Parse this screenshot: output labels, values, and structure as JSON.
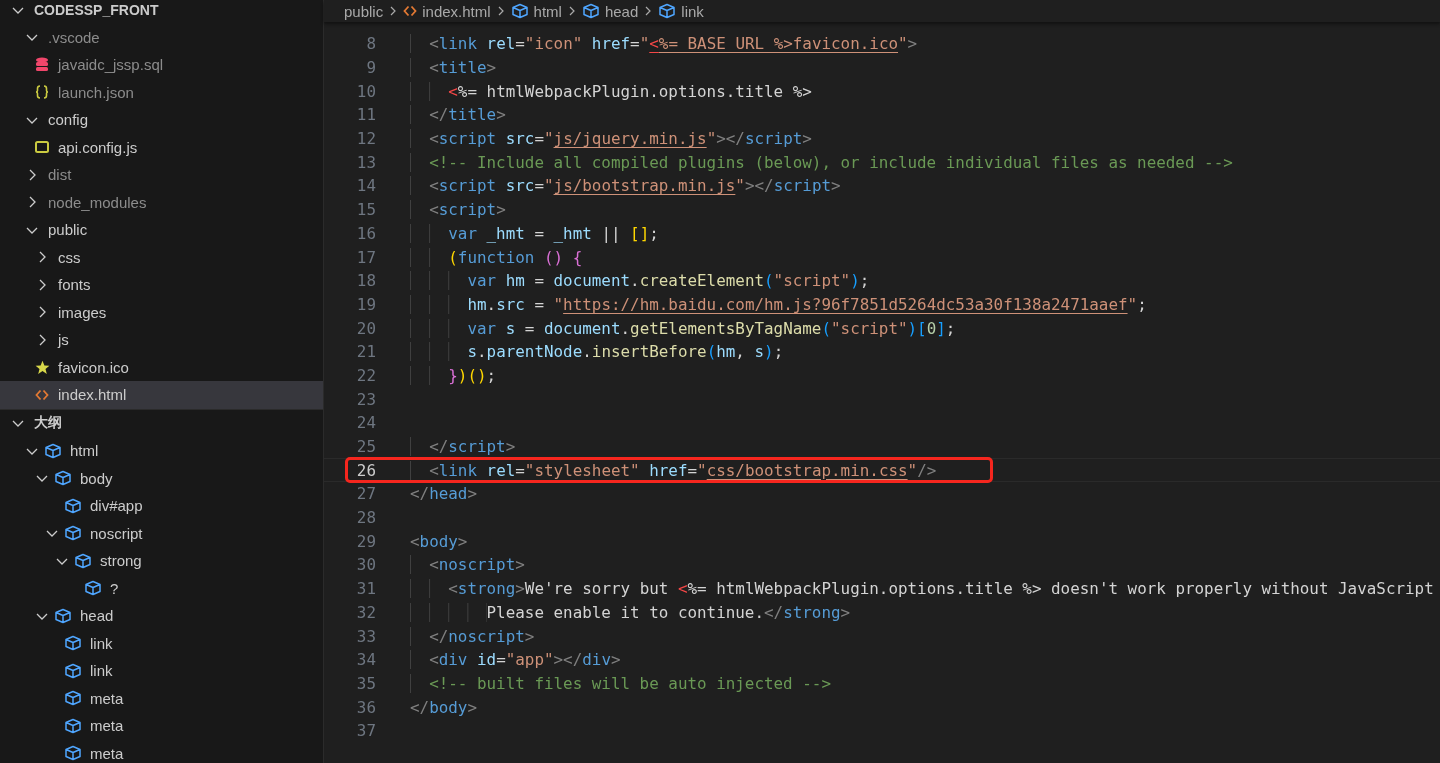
{
  "explorer": {
    "title": "CODESSP_FRONT",
    "expanded": true,
    "items": [
      {
        "label": ".vscode",
        "kind": "folder",
        "expanded": true,
        "dimmed": true,
        "selected": false,
        "children": [
          {
            "label": "javaidc_jssp.sql",
            "kind": "sql",
            "dimmed": true,
            "selected": false
          },
          {
            "label": "launch.json",
            "kind": "json",
            "dimmed": true,
            "selected": false
          }
        ]
      },
      {
        "label": "config",
        "kind": "folder",
        "expanded": true,
        "dimmed": false,
        "selected": false,
        "children": [
          {
            "label": "api.config.js",
            "kind": "js",
            "dimmed": false,
            "selected": false
          }
        ]
      },
      {
        "label": "dist",
        "kind": "folder",
        "expanded": false,
        "dimmed": true,
        "selected": false
      },
      {
        "label": "node_modules",
        "kind": "folder",
        "expanded": false,
        "dimmed": true,
        "selected": false
      },
      {
        "label": "public",
        "kind": "folder",
        "expanded": true,
        "dimmed": false,
        "selected": false,
        "children": [
          {
            "label": "css",
            "kind": "folder",
            "expanded": false,
            "dimmed": false,
            "selected": false
          },
          {
            "label": "fonts",
            "kind": "folder",
            "expanded": false,
            "dimmed": false,
            "selected": false
          },
          {
            "label": "images",
            "kind": "folder",
            "expanded": false,
            "dimmed": false,
            "selected": false
          },
          {
            "label": "js",
            "kind": "folder",
            "expanded": false,
            "dimmed": false,
            "selected": false
          },
          {
            "label": "favicon.ico",
            "kind": "star",
            "dimmed": false,
            "selected": false
          },
          {
            "label": "index.html",
            "kind": "html",
            "dimmed": false,
            "selected": true
          }
        ]
      }
    ]
  },
  "outline": {
    "title": "大纲",
    "expanded": true,
    "items": [
      {
        "label": "html",
        "expanded": true,
        "children": [
          {
            "label": "body",
            "expanded": true,
            "children": [
              {
                "label": "div#app"
              },
              {
                "label": "noscript",
                "expanded": true,
                "children": [
                  {
                    "label": "strong",
                    "expanded": true,
                    "children": [
                      {
                        "label": "?"
                      }
                    ]
                  }
                ]
              }
            ]
          },
          {
            "label": "head",
            "expanded": true,
            "children": [
              {
                "label": "link"
              },
              {
                "label": "link"
              },
              {
                "label": "meta"
              },
              {
                "label": "meta"
              },
              {
                "label": "meta"
              }
            ]
          }
        ]
      }
    ]
  },
  "breadcrumb": [
    {
      "label": "public",
      "kind": "folder"
    },
    {
      "label": "index.html",
      "kind": "html"
    },
    {
      "label": "html",
      "kind": "element"
    },
    {
      "label": "head",
      "kind": "element"
    },
    {
      "label": "link",
      "kind": "element"
    }
  ],
  "code": {
    "lines": [
      {
        "number": "8",
        "current": false,
        "boxed": false,
        "tokens": [
          {
            "kind": "punct",
            "text": "  <"
          },
          {
            "kind": "tag",
            "text": "link"
          },
          {
            "kind": "attr",
            "text": " rel"
          },
          {
            "kind": "op",
            "text": "="
          },
          {
            "kind": "str",
            "text": "\"icon\""
          },
          {
            "kind": "attr",
            "text": " href"
          },
          {
            "kind": "op",
            "text": "="
          },
          {
            "kind": "str",
            "text": "\""
          },
          {
            "kind": "errlink",
            "text": "<"
          },
          {
            "kind": "link",
            "text": "%= BASE_URL %>favicon.ico"
          },
          {
            "kind": "str",
            "text": "\""
          },
          {
            "kind": "punct",
            "text": ">"
          }
        ]
      },
      {
        "number": "9",
        "current": false,
        "boxed": false,
        "tokens": [
          {
            "kind": "punct",
            "text": "  <"
          },
          {
            "kind": "tag",
            "text": "title"
          },
          {
            "kind": "punct",
            "text": ">"
          }
        ]
      },
      {
        "number": "10",
        "current": false,
        "boxed": false,
        "tokens": [
          {
            "kind": "err",
            "text": "    <"
          },
          {
            "kind": "text",
            "text": "%= htmlWebpackPlugin.options.title %>"
          }
        ]
      },
      {
        "number": "11",
        "current": false,
        "boxed": false,
        "tokens": [
          {
            "kind": "punct",
            "text": "  </"
          },
          {
            "kind": "tag",
            "text": "title"
          },
          {
            "kind": "punct",
            "text": ">"
          }
        ]
      },
      {
        "number": "12",
        "current": false,
        "boxed": false,
        "tokens": [
          {
            "kind": "punct",
            "text": "  <"
          },
          {
            "kind": "tag",
            "text": "script"
          },
          {
            "kind": "attr",
            "text": " src"
          },
          {
            "kind": "op",
            "text": "="
          },
          {
            "kind": "str",
            "text": "\""
          },
          {
            "kind": "link",
            "text": "js/jquery.min.js"
          },
          {
            "kind": "str",
            "text": "\""
          },
          {
            "kind": "punct",
            "text": "></"
          },
          {
            "kind": "tag",
            "text": "script"
          },
          {
            "kind": "punct",
            "text": ">"
          }
        ]
      },
      {
        "number": "13",
        "current": false,
        "boxed": false,
        "tokens": [
          {
            "kind": "comment",
            "text": "  <!-- Include all compiled plugins (below), or include individual files as needed -->"
          }
        ]
      },
      {
        "number": "14",
        "current": false,
        "boxed": false,
        "tokens": [
          {
            "kind": "punct",
            "text": "  <"
          },
          {
            "kind": "tag",
            "text": "script"
          },
          {
            "kind": "attr",
            "text": " src"
          },
          {
            "kind": "op",
            "text": "="
          },
          {
            "kind": "str",
            "text": "\""
          },
          {
            "kind": "link",
            "text": "js/bootstrap.min.js"
          },
          {
            "kind": "str",
            "text": "\""
          },
          {
            "kind": "punct",
            "text": "></"
          },
          {
            "kind": "tag",
            "text": "script"
          },
          {
            "kind": "punct",
            "text": ">"
          }
        ]
      },
      {
        "number": "15",
        "current": false,
        "boxed": false,
        "tokens": [
          {
            "kind": "punct",
            "text": "  <"
          },
          {
            "kind": "tag",
            "text": "script"
          },
          {
            "kind": "punct",
            "text": ">"
          }
        ]
      },
      {
        "number": "16",
        "current": false,
        "boxed": false,
        "tokens": [
          {
            "kind": "kw",
            "text": "    var"
          },
          {
            "kind": "var",
            "text": " _hmt"
          },
          {
            "kind": "op",
            "text": " = "
          },
          {
            "kind": "var",
            "text": "_hmt"
          },
          {
            "kind": "op",
            "text": " || "
          },
          {
            "kind": "b1",
            "text": "[]"
          },
          {
            "kind": "op",
            "text": ";"
          }
        ]
      },
      {
        "number": "17",
        "current": false,
        "boxed": false,
        "tokens": [
          {
            "kind": "b1",
            "text": "    ("
          },
          {
            "kind": "kw",
            "text": "function "
          },
          {
            "kind": "b2",
            "text": "() {"
          }
        ]
      },
      {
        "number": "18",
        "current": false,
        "boxed": false,
        "tokens": [
          {
            "kind": "kw",
            "text": "      var"
          },
          {
            "kind": "var",
            "text": " hm"
          },
          {
            "kind": "op",
            "text": " = "
          },
          {
            "kind": "var",
            "text": "document"
          },
          {
            "kind": "op",
            "text": "."
          },
          {
            "kind": "fn",
            "text": "createElement"
          },
          {
            "kind": "b3",
            "text": "("
          },
          {
            "kind": "str",
            "text": "\"script\""
          },
          {
            "kind": "b3",
            "text": ")"
          },
          {
            "kind": "op",
            "text": ";"
          }
        ]
      },
      {
        "number": "19",
        "current": false,
        "boxed": false,
        "tokens": [
          {
            "kind": "var",
            "text": "      hm"
          },
          {
            "kind": "op",
            "text": "."
          },
          {
            "kind": "var",
            "text": "src"
          },
          {
            "kind": "op",
            "text": " = "
          },
          {
            "kind": "str",
            "text": "\""
          },
          {
            "kind": "link",
            "text": "https://hm.baidu.com/hm.js?96f7851d5264dc53a30f138a2471aaef"
          },
          {
            "kind": "str",
            "text": "\""
          },
          {
            "kind": "op",
            "text": ";"
          }
        ]
      },
      {
        "number": "20",
        "current": false,
        "boxed": false,
        "tokens": [
          {
            "kind": "kw",
            "text": "      var"
          },
          {
            "kind": "var",
            "text": " s"
          },
          {
            "kind": "op",
            "text": " = "
          },
          {
            "kind": "var",
            "text": "document"
          },
          {
            "kind": "op",
            "text": "."
          },
          {
            "kind": "fn",
            "text": "getElementsByTagName"
          },
          {
            "kind": "b3",
            "text": "("
          },
          {
            "kind": "str",
            "text": "\"script\""
          },
          {
            "kind": "b3",
            "text": ")["
          },
          {
            "kind": "num",
            "text": "0"
          },
          {
            "kind": "b3",
            "text": "]"
          },
          {
            "kind": "op",
            "text": ";"
          }
        ]
      },
      {
        "number": "21",
        "current": false,
        "boxed": false,
        "tokens": [
          {
            "kind": "var",
            "text": "      s"
          },
          {
            "kind": "op",
            "text": "."
          },
          {
            "kind": "var",
            "text": "parentNode"
          },
          {
            "kind": "op",
            "text": "."
          },
          {
            "kind": "fn",
            "text": "insertBefore"
          },
          {
            "kind": "b3",
            "text": "("
          },
          {
            "kind": "var",
            "text": "hm"
          },
          {
            "kind": "op",
            "text": ", "
          },
          {
            "kind": "var",
            "text": "s"
          },
          {
            "kind": "b3",
            "text": ")"
          },
          {
            "kind": "op",
            "text": ";"
          }
        ]
      },
      {
        "number": "22",
        "current": false,
        "boxed": false,
        "tokens": [
          {
            "kind": "b2",
            "text": "    }"
          },
          {
            "kind": "b1",
            "text": ")()"
          },
          {
            "kind": "op",
            "text": ";"
          }
        ]
      },
      {
        "number": "23",
        "current": false,
        "boxed": false
      },
      {
        "number": "24",
        "current": false,
        "boxed": false
      },
      {
        "number": "25",
        "current": false,
        "boxed": false,
        "tokens": [
          {
            "kind": "punct",
            "text": "  </"
          },
          {
            "kind": "tag",
            "text": "script"
          },
          {
            "kind": "punct",
            "text": ">"
          }
        ]
      },
      {
        "number": "26",
        "current": true,
        "boxed": true,
        "tokens": [
          {
            "kind": "punct",
            "text": "  <"
          },
          {
            "kind": "tag",
            "text": "link"
          },
          {
            "kind": "attr",
            "text": " rel"
          },
          {
            "kind": "op",
            "text": "="
          },
          {
            "kind": "str",
            "text": "\"stylesheet\""
          },
          {
            "kind": "attr",
            "text": " href"
          },
          {
            "kind": "op",
            "text": "="
          },
          {
            "kind": "str",
            "text": "\""
          },
          {
            "kind": "link",
            "text": "css/bootstrap.min.css"
          },
          {
            "kind": "str",
            "text": "\""
          },
          {
            "kind": "punct",
            "text": "/>"
          }
        ]
      },
      {
        "number": "27",
        "current": false,
        "boxed": false,
        "tokens": [
          {
            "kind": "punct",
            "text": "</"
          },
          {
            "kind": "tag",
            "text": "head"
          },
          {
            "kind": "punct",
            "text": ">"
          }
        ]
      },
      {
        "number": "28",
        "current": false,
        "boxed": false
      },
      {
        "number": "29",
        "current": false,
        "boxed": false,
        "tokens": [
          {
            "kind": "punct",
            "text": "<"
          },
          {
            "kind": "tag",
            "text": "body"
          },
          {
            "kind": "punct",
            "text": ">"
          }
        ]
      },
      {
        "number": "30",
        "current": false,
        "boxed": false,
        "tokens": [
          {
            "kind": "punct",
            "text": "  <"
          },
          {
            "kind": "tag",
            "text": "noscript"
          },
          {
            "kind": "punct",
            "text": ">"
          }
        ]
      },
      {
        "number": "31",
        "current": false,
        "boxed": false,
        "tokens": [
          {
            "kind": "punct",
            "text": "    <"
          },
          {
            "kind": "tag",
            "text": "strong"
          },
          {
            "kind": "punct",
            "text": ">"
          },
          {
            "kind": "text",
            "text": "We're sorry but "
          },
          {
            "kind": "err",
            "text": "<"
          },
          {
            "kind": "text",
            "text": "%= htmlWebpackPlugin.options.title %> doesn't work properly without JavaScript"
          }
        ]
      },
      {
        "number": "32",
        "current": false,
        "boxed": false,
        "tokens": [
          {
            "kind": "text",
            "text": "        Please enable it to continue."
          },
          {
            "kind": "punct",
            "text": "</"
          },
          {
            "kind": "tag",
            "text": "strong"
          },
          {
            "kind": "punct",
            "text": ">"
          }
        ]
      },
      {
        "number": "33",
        "current": false,
        "boxed": false,
        "tokens": [
          {
            "kind": "punct",
            "text": "  </"
          },
          {
            "kind": "tag",
            "text": "noscript"
          },
          {
            "kind": "punct",
            "text": ">"
          }
        ]
      },
      {
        "number": "34",
        "current": false,
        "boxed": false,
        "tokens": [
          {
            "kind": "punct",
            "text": "  <"
          },
          {
            "kind": "tag",
            "text": "div"
          },
          {
            "kind": "attr",
            "text": " id"
          },
          {
            "kind": "op",
            "text": "="
          },
          {
            "kind": "str",
            "text": "\"app\""
          },
          {
            "kind": "punct",
            "text": "></"
          },
          {
            "kind": "tag",
            "text": "div"
          },
          {
            "kind": "punct",
            "text": ">"
          }
        ]
      },
      {
        "number": "35",
        "current": false,
        "boxed": false,
        "tokens": [
          {
            "kind": "comment",
            "text": "  <!-- built files will be auto injected -->"
          }
        ]
      },
      {
        "number": "36",
        "current": false,
        "boxed": false,
        "tokens": [
          {
            "kind": "punct",
            "text": "</"
          },
          {
            "kind": "tag",
            "text": "body"
          },
          {
            "kind": "punct",
            "text": ">"
          }
        ]
      },
      {
        "number": "37",
        "current": false,
        "boxed": false
      }
    ]
  }
}
